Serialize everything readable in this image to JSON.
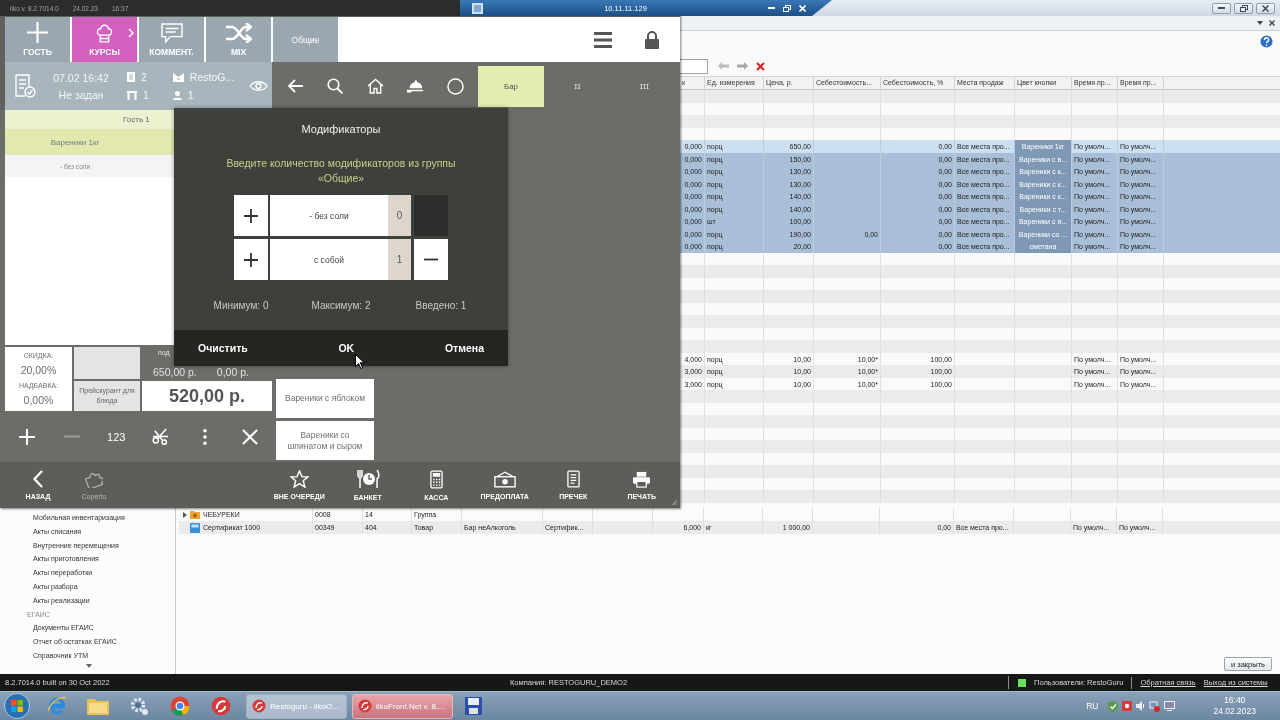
{
  "pos_window": {
    "title_bar": {
      "version": "iiko v. 8.2.7014.0",
      "date": "24.02.23",
      "time": "16:37"
    },
    "top_toolbar": [
      {
        "kind": "plus",
        "label": "ГОСТЬ",
        "active": false,
        "expandable": false
      },
      {
        "kind": "chef-hat",
        "label": "КУРСЫ",
        "active": true,
        "expandable": true
      },
      {
        "kind": "comment",
        "label": "КОММЕНТ.",
        "active": false,
        "expandable": false
      },
      {
        "kind": "shuffle",
        "label": "MIX",
        "active": false,
        "expandable": false
      },
      {
        "kind": "text",
        "label": "Общие",
        "active": false,
        "expandable": false
      }
    ],
    "order_info": {
      "date": "07.02 16:42",
      "status": "Не задан",
      "checks": "2",
      "table": "1",
      "waiter": "RestoG...",
      "guests": "1"
    },
    "nav_tabs": [
      {
        "label": "Бар",
        "selected": true
      },
      {
        "label": "II",
        "selected": false
      },
      {
        "label": "III",
        "selected": false
      }
    ],
    "order": {
      "guest": "Гость 1",
      "items": [
        {
          "kind": "dish",
          "name": "Вареники 1кг",
          "selected": true
        },
        {
          "kind": "modifier",
          "name": "- без соли",
          "selected": false
        }
      ]
    },
    "totals": {
      "discount_label": "СКИДКА:",
      "discount": "20,00%",
      "markup_label": "НАДБАВКА:",
      "markup": "0,00%",
      "subtotal_label": "под",
      "subtotal": "650,00 р.",
      "amount_2": "0,00 р.",
      "price_list_button": "Прейскурант для блюда",
      "total": "520,00 р."
    },
    "actions": [
      {
        "kind": "plus",
        "enabled": true
      },
      {
        "kind": "minus",
        "enabled": false
      },
      {
        "kind": "text",
        "label": "123",
        "enabled": true
      },
      {
        "kind": "split",
        "enabled": true
      },
      {
        "kind": "more",
        "enabled": true
      },
      {
        "kind": "delete",
        "enabled": true
      }
    ],
    "menu_tiles": [
      "Вареники с яблоком",
      "Вареники со шпинатом и сыром"
    ],
    "bottom_bar": [
      {
        "kind": "back",
        "label": "НАЗАД",
        "enabled": true
      },
      {
        "kind": "puzzle",
        "label": "Coperto",
        "enabled": false
      },
      {
        "kind": "star",
        "label": "ВНЕ ОЧЕРЕДИ",
        "enabled": true
      },
      {
        "kind": "banquet",
        "label": "БАНКЕТ",
        "enabled": true
      },
      {
        "kind": "cash",
        "label": "КАССА",
        "enabled": true
      },
      {
        "kind": "prepay",
        "label": "ПРЕДОПЛАТА",
        "enabled": true
      },
      {
        "kind": "precheck",
        "label": "ПРЕЧЕК",
        "enabled": true
      },
      {
        "kind": "print",
        "label": "ПЕЧАТЬ",
        "enabled": true
      }
    ],
    "dialog": {
      "title": "Модификаторы",
      "prompt": "Введите количество модификаторов из группы «Общие»",
      "modifiers": [
        {
          "name": "- без соли",
          "count": "0",
          "can_decrease": false
        },
        {
          "name": "с собой",
          "count": "1",
          "can_decrease": true
        }
      ],
      "limits": [
        "Минимум: 0",
        "Максимум: 2",
        "Введено: 1"
      ],
      "buttons": [
        "Очистить",
        "OK",
        "Отмена"
      ]
    }
  },
  "remote_desktop_bar": {
    "host": "10.11.11.129"
  },
  "back_office": {
    "table": {
      "columns": [
        "к",
        "Ед. измерения",
        "Цена, р.",
        "Себестоимость...",
        "Себестоимость, %",
        "Места продаж",
        "Цвет кнопки",
        "Время пр...",
        "Время пр..."
      ],
      "rows": [
        {
          "selected": false,
          "focused": false
        },
        {
          "selected": false,
          "focused": false
        },
        {
          "selected": false,
          "focused": false
        },
        {
          "selected": false,
          "focused": false
        },
        {
          "selected": true,
          "focused": true,
          "cells": [
            "0,000",
            "порц",
            "650,00",
            null,
            "0,00",
            "Все места про...",
            "Вареники 1кг",
            "По умолч...",
            "По умолч..."
          ]
        },
        {
          "selected": true,
          "focused": false,
          "cells": [
            "0,000",
            "порц",
            "150,00",
            null,
            "0,00",
            "Все места про...",
            "Вареники с в...",
            "По умолч...",
            "По умолч..."
          ]
        },
        {
          "selected": true,
          "focused": false,
          "cells": [
            "0,000",
            "порц",
            "130,00",
            null,
            "0,00",
            "Все места про...",
            "Вареники с к...",
            "По умолч...",
            "По умолч..."
          ]
        },
        {
          "selected": true,
          "focused": false,
          "cells": [
            "0,000",
            "порц",
            "130,00",
            null,
            "0,00",
            "Все места про...",
            "Вареники с к...",
            "По умолч...",
            "По умолч..."
          ]
        },
        {
          "selected": true,
          "focused": false,
          "cells": [
            "0,000",
            "порц",
            "140,00",
            null,
            "0,00",
            "Все места про...",
            "Вареники с к...",
            "По умолч...",
            "По умолч..."
          ]
        },
        {
          "selected": true,
          "focused": false,
          "cells": [
            "0,000",
            "порц",
            "140,00",
            null,
            "0,00",
            "Все места про...",
            "Вареники с т...",
            "По умолч...",
            "По умолч..."
          ]
        },
        {
          "selected": true,
          "focused": false,
          "cells": [
            "0,000",
            "шт",
            "100,00",
            null,
            "0,00",
            "Все места про...",
            "Вареники с я...",
            "По умолч...",
            "По умолч..."
          ]
        },
        {
          "selected": true,
          "focused": false,
          "cells": [
            "0,000",
            "порц",
            "190,00",
            "0,00",
            "0,00",
            "Все места про...",
            "Вареники со ...",
            "По умолч...",
            "По умолч..."
          ]
        },
        {
          "selected": true,
          "focused": false,
          "cells": [
            "0,000",
            "порц",
            "20,00",
            null,
            "0,00",
            "Все места про...",
            "сметана",
            "По умолч...",
            "По умолч..."
          ]
        },
        {
          "selected": false,
          "focused": false
        },
        {
          "selected": false,
          "focused": false
        },
        {
          "selected": false,
          "focused": false
        },
        {
          "selected": false,
          "focused": false
        },
        {
          "selected": false,
          "focused": false
        },
        {
          "selected": false,
          "focused": false
        },
        {
          "selected": false,
          "focused": false
        },
        {
          "selected": false,
          "focused": false
        },
        {
          "selected": false,
          "focused": false,
          "cells": [
            "4,000",
            "порц",
            "10,00",
            "10,00*",
            "100,00",
            null,
            null,
            "По умолч...",
            "По умолч..."
          ]
        },
        {
          "selected": false,
          "focused": false,
          "cells": [
            "3,000",
            "порц",
            "10,00",
            "10,00*",
            "100,00",
            null,
            null,
            "По умолч...",
            "По умолч..."
          ]
        },
        {
          "selected": false,
          "focused": false,
          "cells": [
            "3,000",
            "порц",
            "10,00",
            "10,00*",
            "100,00",
            null,
            null,
            "По умолч...",
            "По умолч..."
          ]
        },
        {
          "selected": false,
          "focused": false
        },
        {
          "selected": false,
          "focused": false
        },
        {
          "selected": false,
          "focused": false
        },
        {
          "selected": false,
          "focused": false
        },
        {
          "selected": false,
          "focused": false
        },
        {
          "selected": false,
          "focused": false
        },
        {
          "selected": false,
          "focused": false
        },
        {
          "selected": false,
          "focused": false
        },
        {
          "selected": false,
          "focused": false
        },
        {
          "selected": false,
          "focused": false,
          "kind": "group",
          "name": "ЧЕБУРЕКИ",
          "left_cells": [
            "0008",
            "14",
            "Группа"
          ]
        },
        {
          "selected": false,
          "focused": false,
          "kind": "item",
          "name": "Сертификат 1000",
          "left_cells": [
            "00349",
            "404",
            "Товар",
            "Бар неАлкоголь",
            "Сертифик..."
          ],
          "cells": [
            "6,000",
            "кг",
            "1 000,00",
            null,
            "0,00",
            "Все места про...",
            null,
            "По умолч...",
            "По умолч..."
          ]
        }
      ]
    },
    "sidebar": {
      "items": [
        {
          "kind": "item",
          "label": "Мобильная инвентаризация"
        },
        {
          "kind": "item",
          "label": "Акты списания"
        },
        {
          "kind": "item",
          "label": "Внутренние перемещения"
        },
        {
          "kind": "item",
          "label": "Акты приготовления"
        },
        {
          "kind": "item",
          "label": "Акты переработки"
        },
        {
          "kind": "item",
          "label": "Акты разбора"
        },
        {
          "kind": "item",
          "label": "Акты реализации"
        },
        {
          "kind": "section",
          "label": "ЕГАИС"
        },
        {
          "kind": "item",
          "label": "Документы ЕГАИС"
        },
        {
          "kind": "item",
          "label": "Отчет об остатках ЕГАИС"
        },
        {
          "kind": "item",
          "label": "Справочник УТМ"
        }
      ]
    },
    "close_button": "и закрыть",
    "status_bar": {
      "version": "8.2.7014.0 built on 30 Oct 2022",
      "company": "Компания: RESTOGURU_DEMO2",
      "online": true,
      "users": "Пользователи: RestoGuru",
      "links": [
        "Обратная связь",
        "Выход из системы"
      ]
    }
  },
  "taskbar": {
    "tasks": [
      {
        "label": "Restoguru - iikoO...",
        "active": false
      },
      {
        "label": "iikoFront.Net v. 8....",
        "active": true
      }
    ],
    "language": "RU",
    "time": "16:40",
    "date": "24.02.2023"
  }
}
